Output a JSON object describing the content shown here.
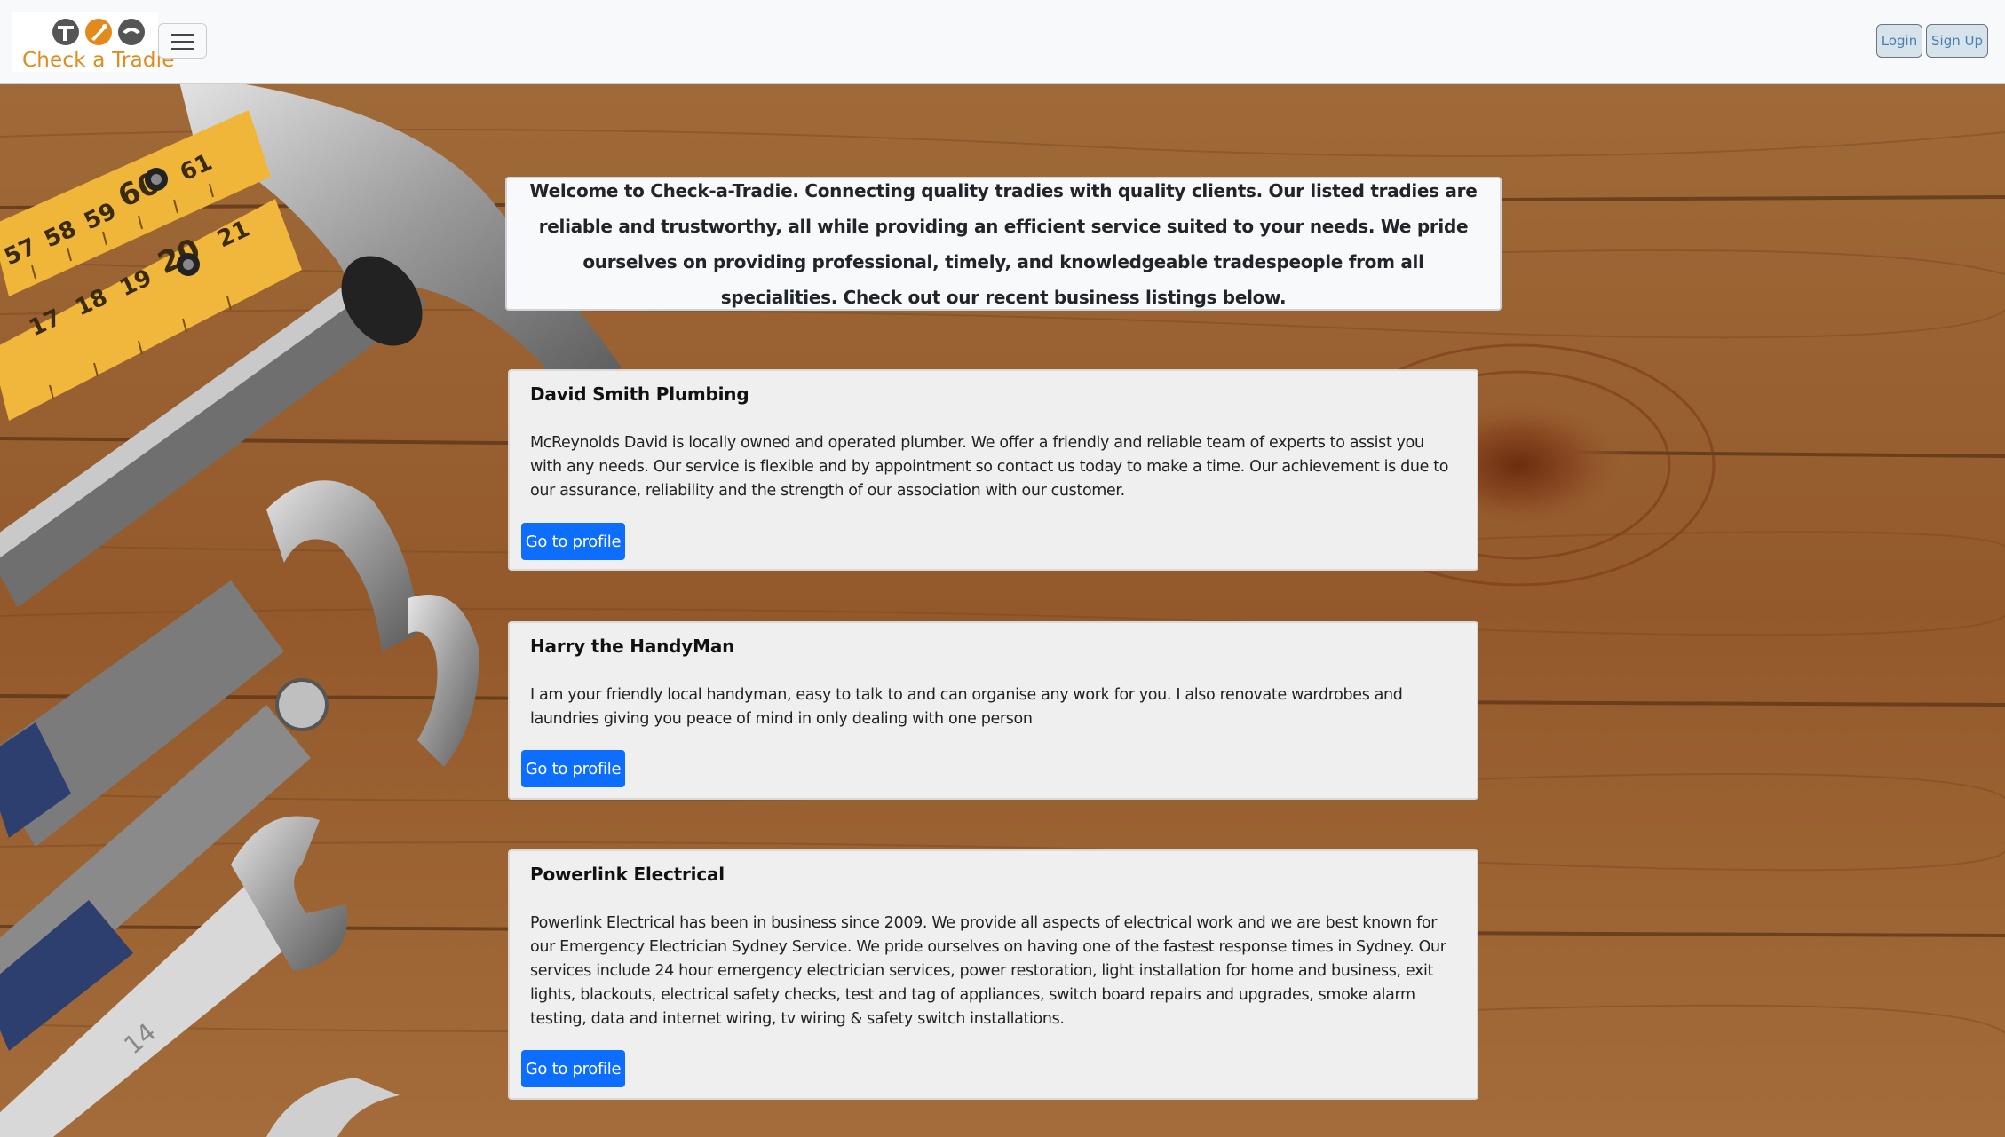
{
  "brand": {
    "name": "Check a Tradie",
    "logo_icon": "tools-logo-icon"
  },
  "nav": {
    "menu_icon": "hamburger-menu-icon",
    "login_label": "Login",
    "signup_label": "Sign Up"
  },
  "welcome": {
    "text": "Welcome to Check-a-Tradie. Connecting quality tradies with quality clients. Our listed tradies are reliable and trustworthy, all while providing an efficient service suited to your needs. We pride ourselves on providing professional, timely, and knowledgeable tradespeople from all specialities. Check out our recent business listings below."
  },
  "listings": [
    {
      "title": "David Smith Plumbing",
      "description": "McReynolds David is locally owned and operated plumber. We offer a friendly and reliable team of experts to assist you with any needs. Our service is flexible and by appointment so contact us today to make a time. Our achievement is due to our assurance, reliability and the strength of our association with our customer.",
      "button_label": "Go to profile"
    },
    {
      "title": "Harry the HandyMan",
      "description": "I am your friendly local handyman, easy to talk to and can organise any work for you. I also renovate wardrobes and laundries giving you peace of mind in only dealing with one person",
      "button_label": "Go to profile"
    },
    {
      "title": "Powerlink Electrical",
      "description": "Powerlink Electrical has been in business since 2009. We provide all aspects of electrical work and we are best known for our Emergency Electrician Sydney Service. We pride ourselves on having one of the fastest response times in Sydney. Our services include 24 hour emergency electrician services, power restoration, light installation for home and business, exit lights, blackouts, electrical safety checks, test and tag of appliances, switch board repairs and upgrades, smoke alarm testing, data and internet wiring, tv wiring & safety switch installations.",
      "button_label": "Go to profile"
    }
  ],
  "background": {
    "ruler_numbers": [
      "61",
      "60",
      "59",
      "58",
      "57",
      "21",
      "20",
      "19",
      "18",
      "17"
    ],
    "wrench_number": "14"
  },
  "colors": {
    "brand_orange": "#e48a1d",
    "primary_blue": "#0d6efd",
    "wood": "#9a6434"
  }
}
